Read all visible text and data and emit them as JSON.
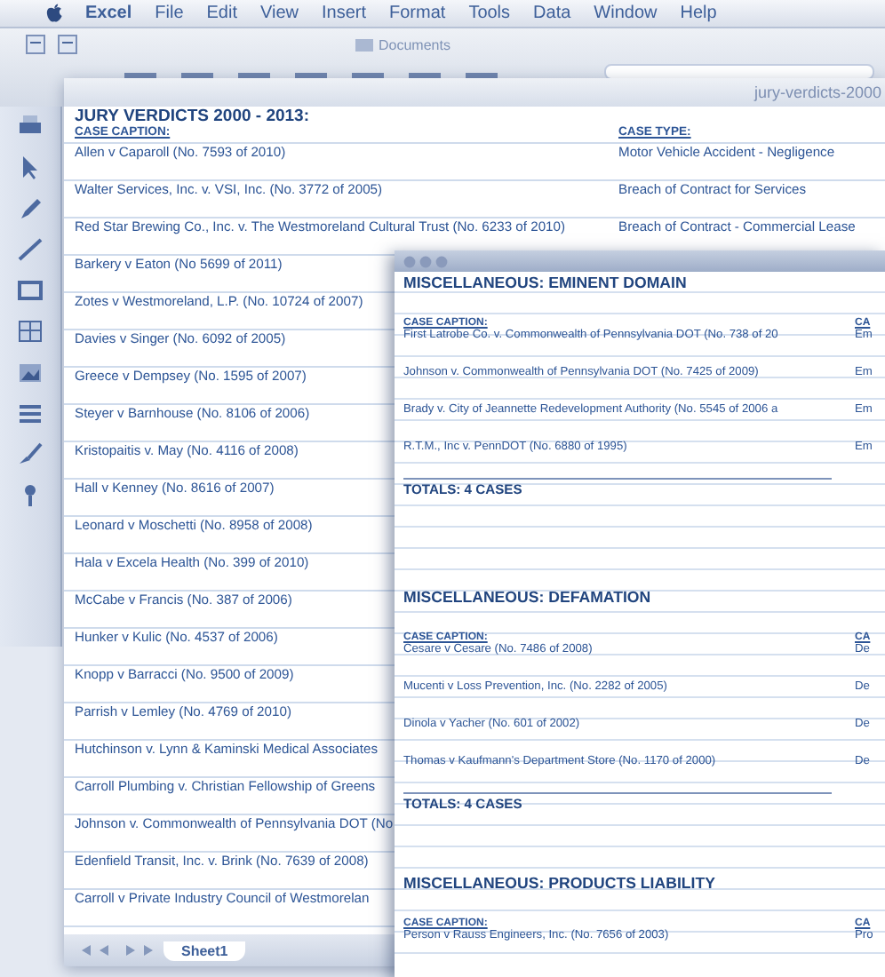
{
  "menu_bar": {
    "app": "Excel",
    "items": [
      "File",
      "Edit",
      "View",
      "Insert",
      "Format",
      "Tools",
      "Data",
      "Window",
      "Help"
    ]
  },
  "toolbar": {
    "location": "Documents"
  },
  "workbook_window": {
    "title": "jury-verdicts-2000",
    "heading": "JURY VERDICTS 2000 - 2013:",
    "columns": [
      "CASE CAPTION:",
      "CASE TYPE:"
    ],
    "rows": [
      {
        "caption": "Allen v Caparoll (No. 7593 of 2010)",
        "case_type": "Motor Vehicle Accident - Negligence"
      },
      {
        "caption": "Walter Services, Inc. v. VSI, Inc. (No. 3772 of 2005)",
        "case_type": "Breach of Contract for Services"
      },
      {
        "caption": "Red Star Brewing Co., Inc. v. The Westmoreland Cultural Trust (No. 6233 of 2010)",
        "case_type": "Breach of Contract - Commercial Lease"
      },
      {
        "caption": "Barkery v Eaton (No 5699 of 2011)"
      },
      {
        "caption": "Zotes v Westmoreland, L.P. (No. 10724 of 2007)"
      },
      {
        "caption": "Davies v Singer (No. 6092 of 2005)"
      },
      {
        "caption": "Greece v Dempsey (No. 1595 of 2007)"
      },
      {
        "caption": "Steyer v Barnhouse (No. 8106 of 2006)"
      },
      {
        "caption": "Kristopaitis v. May (No. 4116 of 2008)"
      },
      {
        "caption": "Hall v Kenney (No. 8616 of 2007)"
      },
      {
        "caption": "Leonard v Moschetti (No. 8958 of 2008)"
      },
      {
        "caption": "Hala v Excela Health (No. 399 of 2010)"
      },
      {
        "caption": "McCabe v Francis (No. 387 of 2006)"
      },
      {
        "caption": "Hunker v Kulic (No. 4537 of 2006)"
      },
      {
        "caption": "Knopp v Barracci (No. 9500 of 2009)"
      },
      {
        "caption": "Parrish v Lemley (No. 4769 of 2010)"
      },
      {
        "caption": "Hutchinson v. Lynn & Kaminski Medical Associates"
      },
      {
        "caption": "Carroll Plumbing v. Christian Fellowship of Greens"
      },
      {
        "caption": "Johnson v. Commonwealth of Pennsylvania DOT (No"
      },
      {
        "caption": "Edenfield Transit, Inc. v. Brink (No. 7639 of 2008)"
      },
      {
        "caption": "Carroll v Private Industry Council of Westmorelan"
      }
    ],
    "sheet_tabs": [
      {
        "label": "Sheet1",
        "selected": true
      }
    ]
  },
  "front_window": {
    "sections": [
      {
        "title": "MISCELLANEOUS: EMINENT DOMAIN",
        "columns": [
          "CASE CAPTION:",
          "CA"
        ],
        "total": "TOTALS: 4 CASES",
        "rows": [
          {
            "caption": "First Latrobe Co. v. Commonwealth of Pennsylvania DOT (No. 738 of 20",
            "case_type": "Em"
          },
          {
            "caption": "Johnson v. Commonwealth of Pennsylvania DOT (No. 7425 of 2009)",
            "case_type": "Em"
          },
          {
            "caption": "Brady v. City of Jeannette Redevelopment Authority (No. 5545 of 2006 a",
            "case_type": "Em"
          },
          {
            "caption": "R.T.M., Inc v. PennDOT (No. 6880 of 1995)",
            "case_type": "Em"
          }
        ]
      },
      {
        "title": "MISCELLANEOUS: DEFAMATION",
        "columns": [
          "CASE CAPTION:",
          "CA"
        ],
        "total": "TOTALS: 4 CASES",
        "rows": [
          {
            "caption": "Cesare v Cesare (No. 7486 of 2008)",
            "case_type": "De"
          },
          {
            "caption": "Mucenti v Loss Prevention, Inc. (No. 2282 of 2005)",
            "case_type": "De"
          },
          {
            "caption": "Dinola v Yacher (No. 601 of 2002)",
            "case_type": "De"
          },
          {
            "caption": "Thomas v Kaufmann's Department Store (No. 1170 of 2000)",
            "case_type": "De"
          }
        ]
      },
      {
        "title": "MISCELLANEOUS: PRODUCTS LIABILITY",
        "columns": [
          "CASE CAPTION:",
          "CA"
        ],
        "rows": [
          {
            "caption": "Person v Rauss Engineers, Inc. (No. 7656 of 2003)",
            "case_type": "Pro"
          }
        ]
      }
    ]
  }
}
